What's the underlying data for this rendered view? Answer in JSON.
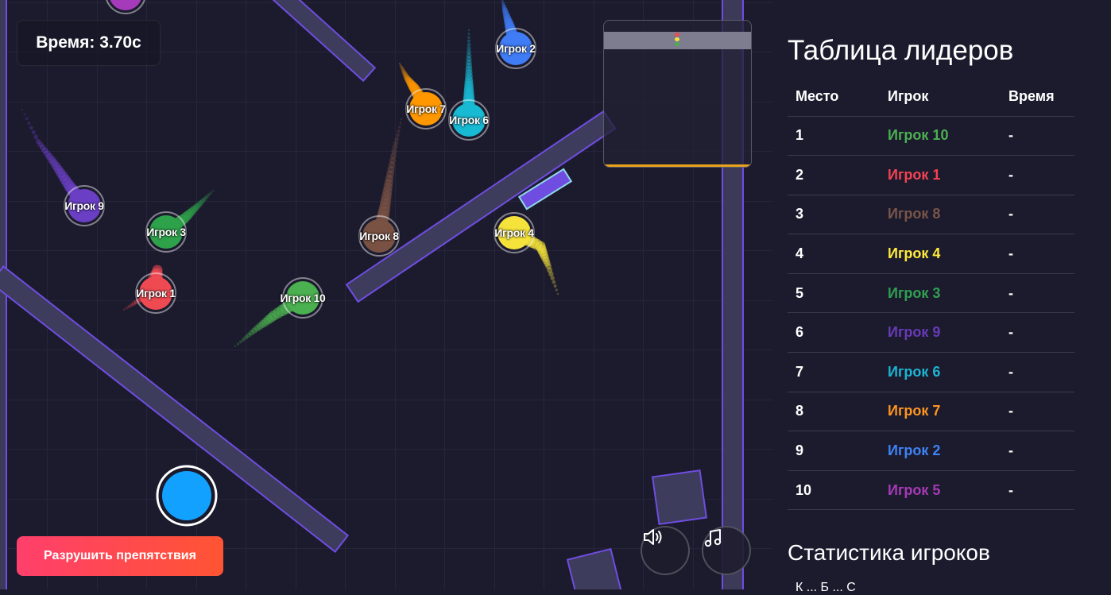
{
  "game": {
    "timer_text": "Время: 3.70с",
    "destroy_button_label": "Разрушить препятствия",
    "sound_icon": "speaker-icon",
    "music_icon": "music-note-icon",
    "accent_color": "#7a4fe0",
    "players": [
      {
        "label": "Игрок 9",
        "color": "#6a3fc4"
      },
      {
        "label": "Игрок 3",
        "color": "#2ea24a"
      },
      {
        "label": "Игрок 1",
        "color": "#ef4a52"
      },
      {
        "label": "Игрок 10",
        "color": "#4bb04f"
      },
      {
        "label": "Игрок 8",
        "color": "#7a5244"
      },
      {
        "label": "Игрок 7",
        "color": "#ff9800"
      },
      {
        "label": "Игрок 6",
        "color": "#18b9d3"
      },
      {
        "label": "Игрок 2",
        "color": "#3f7cf5"
      },
      {
        "label": "Игрок 4",
        "color": "#f5e33b"
      },
      {
        "label": "Игрок 5",
        "color": "#a53bba"
      }
    ]
  },
  "leaderboard": {
    "title": "Таблица лидеров",
    "headers": [
      "Место",
      "Игрок",
      "Время"
    ],
    "rows": [
      {
        "place": "1",
        "player": "Игрок 10",
        "time": "-",
        "color": "#4caf50"
      },
      {
        "place": "2",
        "player": "Игрок 1",
        "time": "-",
        "color": "#f44352"
      },
      {
        "place": "3",
        "player": "Игрок 8",
        "time": "-",
        "color": "#795548"
      },
      {
        "place": "4",
        "player": "Игрок 4",
        "time": "-",
        "color": "#ffeb3b"
      },
      {
        "place": "5",
        "player": "Игрок 3",
        "time": "-",
        "color": "#2ea050"
      },
      {
        "place": "6",
        "player": "Игрок 9",
        "time": "-",
        "color": "#673ab7"
      },
      {
        "place": "7",
        "player": "Игрок 6",
        "time": "-",
        "color": "#1cb4d2"
      },
      {
        "place": "8",
        "player": "Игрок 7",
        "time": "-",
        "color": "#ff9420"
      },
      {
        "place": "9",
        "player": "Игрок 2",
        "time": "-",
        "color": "#3f83f4"
      },
      {
        "place": "10",
        "player": "Игрок 5",
        "time": "-",
        "color": "#a63ab6"
      }
    ]
  },
  "stats": {
    "title": "Статистика игроков",
    "row_text": "К    ...    Б    ...    С"
  }
}
